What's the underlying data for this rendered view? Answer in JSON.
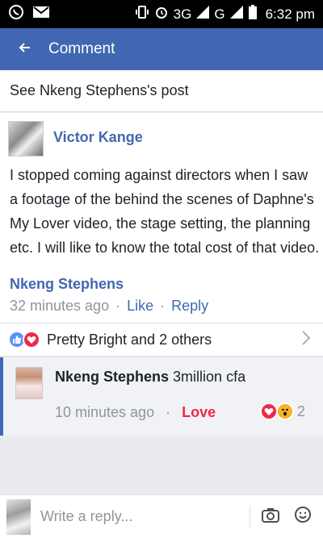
{
  "status_bar": {
    "network_label": "3G",
    "network_label_2": "G",
    "time": "6:32 pm"
  },
  "app_bar": {
    "title": "Comment"
  },
  "post_link": {
    "text": "See Nkeng Stephens's post"
  },
  "comment": {
    "author": "Victor Kange",
    "text": "I stopped coming against directors when I saw a footage of the behind the scenes of Daphne's My Lover video, the stage setting, the planning etc. I will like to know the total cost of that video.",
    "mention": "Nkeng Stephens",
    "time": "32 minutes ago",
    "like_label": "Like",
    "reply_label": "Reply",
    "separator": "·"
  },
  "reactions": {
    "summary": "Pretty Bright and 2 others"
  },
  "reply": {
    "author": "Nkeng Stephens",
    "text": "3million cfa",
    "time": "10 minutes ago",
    "separator": "·",
    "love_label": "Love",
    "reaction_count": "2"
  },
  "composer": {
    "placeholder": "Write a reply..."
  },
  "colors": {
    "brand": "#4267b2",
    "love": "#f0284a",
    "like": "#5890ff",
    "wow": "#f7b125"
  },
  "icons": [
    "whatsapp-icon",
    "gmail-icon",
    "vibrate-icon",
    "alarm-icon",
    "signal-icon",
    "battery-icon",
    "back-arrow-icon",
    "like-reaction-icon",
    "love-reaction-icon",
    "chevron-right-icon",
    "wow-reaction-icon",
    "camera-icon",
    "emoji-icon"
  ]
}
